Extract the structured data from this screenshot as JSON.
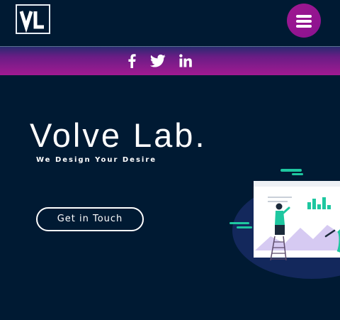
{
  "header": {
    "logo_text": "VL",
    "menu_icon": "hamburger-menu-icon"
  },
  "social": {
    "icons": [
      "facebook-icon",
      "twitter-icon",
      "linkedin-icon"
    ]
  },
  "hero": {
    "title": "Volve Lab.",
    "subtitle": "We Design Your Desire",
    "cta_label": "Get in Touch"
  },
  "colors": {
    "background": "#001a33",
    "accent": "#a01890",
    "illustration_green": "#1ec7a0"
  }
}
